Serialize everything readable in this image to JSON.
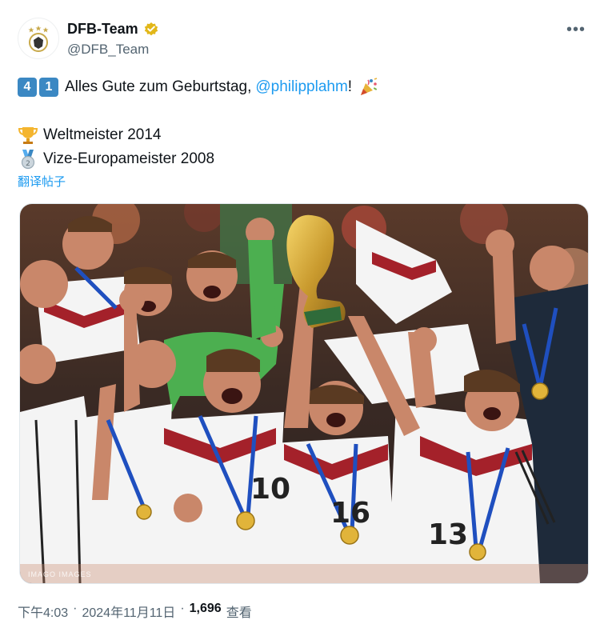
{
  "account": {
    "name": "DFB-Team",
    "handle": "@DFB_Team"
  },
  "tweet": {
    "keycap1": "4",
    "keycap2": "1",
    "greeting": "Alles Gute zum Geburtstag,",
    "mention": "@philipplahm",
    "exclaim": "!",
    "line2": "Weltmeister 2014",
    "line3": "Vize-Europameister 2008",
    "translate_label": "翻译帖子"
  },
  "media": {
    "watermark": "IMAGO IMAGES",
    "jersey_numbers": [
      "10",
      "16",
      "13"
    ]
  },
  "footer": {
    "time": "下午4:03",
    "date": "2024年11月11日",
    "views": "1,696",
    "views_label": "查看",
    "sep": "·"
  },
  "colors": {
    "link": "#1d9bf0",
    "verified": "#e2b719",
    "keycap": "#3b88c3"
  },
  "icons": [
    "verified-badge-icon",
    "more-icon",
    "trophy-icon",
    "silver-medal-icon",
    "party-popper-icon"
  ]
}
